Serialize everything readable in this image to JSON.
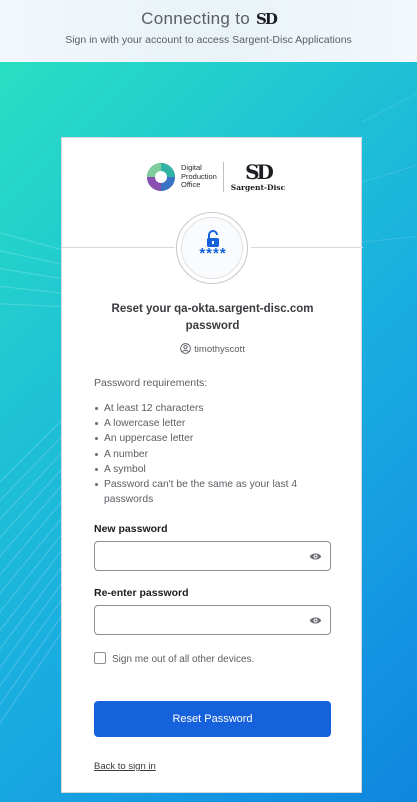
{
  "header": {
    "title": "Connecting to",
    "brand_mark": "SD",
    "subtitle": "Sign in with your account to access Sargent-Disc Applications"
  },
  "logos": {
    "dpo_line1": "Digital",
    "dpo_line2": "Production",
    "dpo_line3": "Office",
    "sd_letters": "SD",
    "sd_name": "Sargent-Disc"
  },
  "badge": {
    "masked": "****",
    "icon": "unlocked-padlock-icon"
  },
  "form": {
    "heading": "Reset your qa-okta.sargent-disc.com password",
    "username": "timothyscott",
    "requirements_title": "Password requirements:",
    "requirements": [
      "At least 12 characters",
      "A lowercase letter",
      "An uppercase letter",
      "A number",
      "A symbol",
      "Password can't be the same as your last 4 passwords"
    ],
    "new_password_label": "New password",
    "new_password_value": "",
    "reenter_password_label": "Re-enter password",
    "reenter_password_value": "",
    "signout_label": "Sign me out of all other devices.",
    "signout_checked": false,
    "submit_label": "Reset Password",
    "back_link": "Back to sign in"
  },
  "colors": {
    "primary": "#1662dd",
    "background_start": "#28e0c2",
    "background_end": "#0e86dc"
  }
}
